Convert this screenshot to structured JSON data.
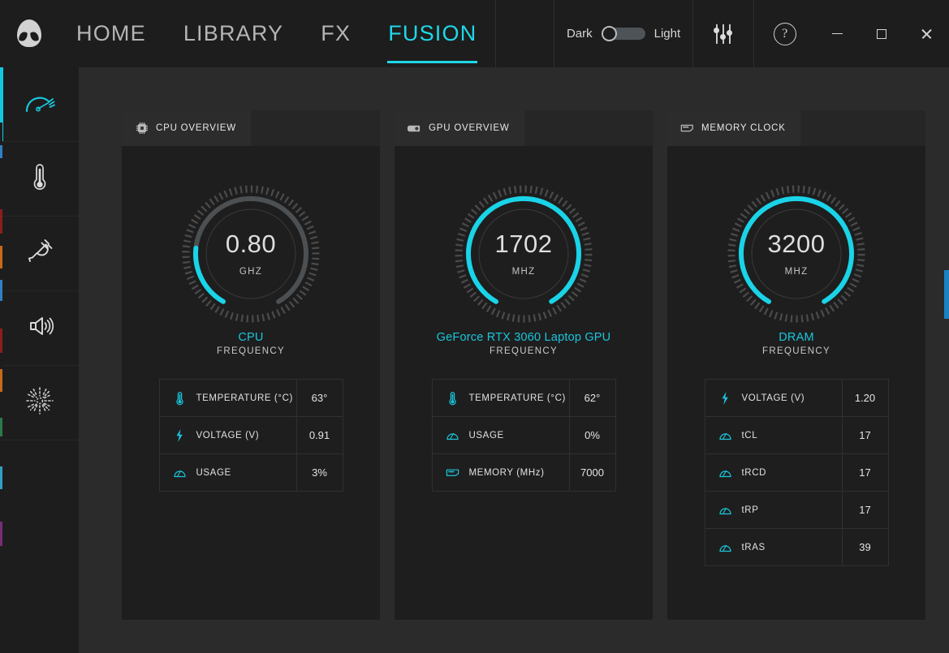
{
  "app": {
    "logo": "alienware-head-icon",
    "nav": [
      {
        "label": "HOME",
        "active": false
      },
      {
        "label": "LIBRARY",
        "active": false
      },
      {
        "label": "FX",
        "active": false
      },
      {
        "label": "FUSION",
        "active": true
      }
    ],
    "theme_toggle": {
      "dark_label": "Dark",
      "light_label": "Light",
      "state": "dark"
    },
    "equalizer_icon": "sliders-icon",
    "help_icon": "question-mark-icon",
    "window_controls": {
      "minimize": "minimize-icon",
      "maximize": "maximize-icon",
      "close": "close-icon"
    },
    "accent_color": "#19c6dc"
  },
  "sidebar": {
    "items": [
      {
        "icon": "gauge-icon",
        "name": "performance",
        "active": true
      },
      {
        "icon": "thermometer-icon",
        "name": "thermals",
        "active": false
      },
      {
        "icon": "power-plug-icon",
        "name": "power",
        "active": false
      },
      {
        "icon": "speaker-icon",
        "name": "audio",
        "active": false
      },
      {
        "icon": "fan-burst-icon",
        "name": "lighting",
        "active": false
      }
    ]
  },
  "panels": [
    {
      "tab_label": "CPU OVERVIEW",
      "tab_icon": "cpu-chip-icon",
      "gauge": {
        "value": "0.80",
        "unit": "GHZ",
        "name": "CPU",
        "sub": "FREQUENCY",
        "percent": 22
      },
      "stats": [
        {
          "icon": "thermometer-icon",
          "label": "TEMPERATURE (°C)",
          "value": "63°"
        },
        {
          "icon": "bolt-icon",
          "label": "VOLTAGE (V)",
          "value": "0.91"
        },
        {
          "icon": "gauge-icon",
          "label": "USAGE",
          "value": "3%"
        }
      ]
    },
    {
      "tab_label": "GPU OVERVIEW",
      "tab_icon": "graphics-card-icon",
      "gauge": {
        "value": "1702",
        "unit": "MHZ",
        "name": "GeForce RTX 3060 Laptop GPU",
        "sub": "FREQUENCY",
        "percent": 100
      },
      "stats": [
        {
          "icon": "thermometer-icon",
          "label": "TEMPERATURE (°C)",
          "value": "62°"
        },
        {
          "icon": "gauge-icon",
          "label": "USAGE",
          "value": "0%"
        },
        {
          "icon": "memory-stick-icon",
          "label": "MEMORY (MHz)",
          "value": "7000"
        }
      ]
    },
    {
      "tab_label": "MEMORY CLOCK",
      "tab_icon": "memory-stick-icon",
      "gauge": {
        "value": "3200",
        "unit": "MHZ",
        "name": "DRAM",
        "sub": "FREQUENCY",
        "percent": 100
      },
      "stats": [
        {
          "icon": "bolt-icon",
          "label": "VOLTAGE (V)",
          "value": "1.20"
        },
        {
          "icon": "gauge-icon",
          "label": "tCL",
          "value": "17"
        },
        {
          "icon": "gauge-icon",
          "label": "tRCD",
          "value": "17"
        },
        {
          "icon": "gauge-icon",
          "label": "tRP",
          "value": "17"
        },
        {
          "icon": "gauge-icon",
          "label": "tRAS",
          "value": "39"
        }
      ]
    }
  ]
}
